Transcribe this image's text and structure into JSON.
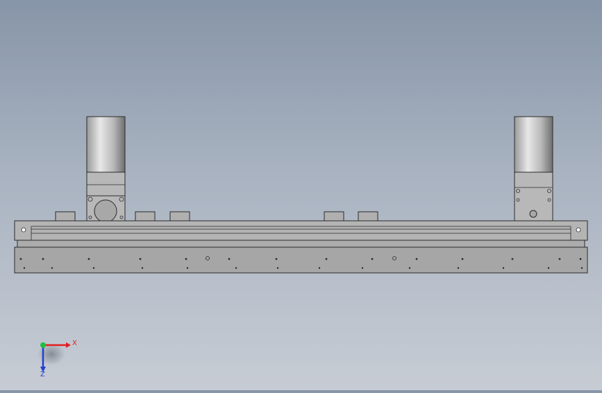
{
  "viewport": {
    "background_top": "#8795a8",
    "background_bottom": "#c7ccd4"
  },
  "model": {
    "part_fill": "#b8b8b8",
    "part_fill_dark": "#a2a2a2",
    "edge_color": "#2a2a2a",
    "motor_left": {
      "icon": "stepper-motor-with-gearbox"
    },
    "motor_right": {
      "icon": "stepper-motor"
    }
  },
  "triad": {
    "x_label": "X",
    "z_label": "Z",
    "x_color": "#e02020",
    "y_color": "#20c040",
    "z_color": "#2040d0"
  }
}
